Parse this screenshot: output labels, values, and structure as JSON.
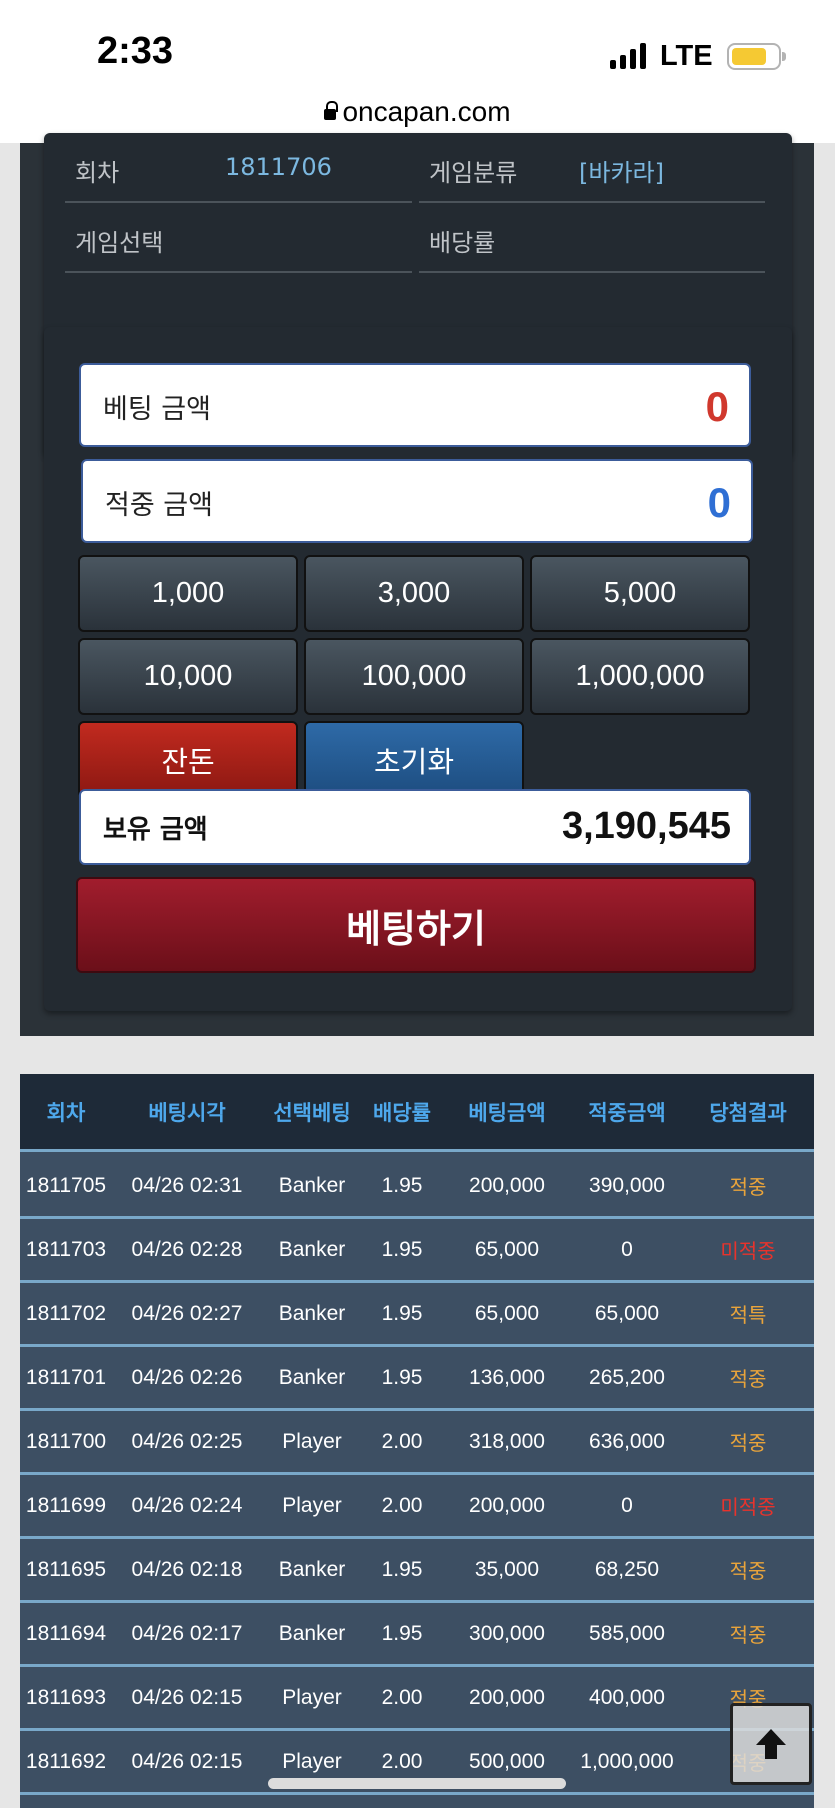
{
  "status": {
    "time": "2:33",
    "network": "LTE"
  },
  "browser": {
    "url": "oncapan.com"
  },
  "info": {
    "round_label": "회차",
    "round_value": "1811706",
    "category_label": "게임분류",
    "category_value": "[바카라]",
    "select_label": "게임선택",
    "odds_label": "배당률"
  },
  "bet": {
    "bet_amount_label": "베팅 금액",
    "bet_amount_value": "0",
    "win_amount_label": "적중 금액",
    "win_amount_value": "0",
    "chips": [
      "1,000",
      "3,000",
      "5,000",
      "10,000",
      "100,000",
      "1,000,000"
    ],
    "change_label": "잔돈",
    "reset_label": "초기화",
    "hold_label": "보유 금액",
    "hold_value": "3,190,545",
    "submit_label": "베팅하기",
    "colors": {
      "bet_value": "#d0382d",
      "win_value": "#2f6fd4"
    }
  },
  "history": {
    "headers": [
      "회차",
      "베팅시각",
      "선택베팅",
      "배당률",
      "베팅금액",
      "적중금액",
      "당첨결과"
    ],
    "rows": [
      [
        "1811705",
        "04/26 02:31",
        "Banker",
        "1.95",
        "200,000",
        "390,000",
        "적중"
      ],
      [
        "1811703",
        "04/26 02:28",
        "Banker",
        "1.95",
        "65,000",
        "0",
        "미적중"
      ],
      [
        "1811702",
        "04/26 02:27",
        "Banker",
        "1.95",
        "65,000",
        "65,000",
        "적특"
      ],
      [
        "1811701",
        "04/26 02:26",
        "Banker",
        "1.95",
        "136,000",
        "265,200",
        "적중"
      ],
      [
        "1811700",
        "04/26 02:25",
        "Player",
        "2.00",
        "318,000",
        "636,000",
        "적중"
      ],
      [
        "1811699",
        "04/26 02:24",
        "Player",
        "2.00",
        "200,000",
        "0",
        "미적중"
      ],
      [
        "1811695",
        "04/26 02:18",
        "Banker",
        "1.95",
        "35,000",
        "68,250",
        "적중"
      ],
      [
        "1811694",
        "04/26 02:17",
        "Banker",
        "1.95",
        "300,000",
        "585,000",
        "적중"
      ],
      [
        "1811693",
        "04/26 02:15",
        "Player",
        "2.00",
        "200,000",
        "400,000",
        "적중"
      ],
      [
        "1811692",
        "04/26 02:15",
        "Player",
        "2.00",
        "500,000",
        "1,000,000",
        "적중"
      ]
    ],
    "result_colors": {
      "적중": "#e9a43b",
      "미적중": "#e8332c",
      "적특": "#e9a43b"
    }
  },
  "icons": {
    "scroll_top": "arrow-up-icon",
    "lock": "lock-icon"
  }
}
